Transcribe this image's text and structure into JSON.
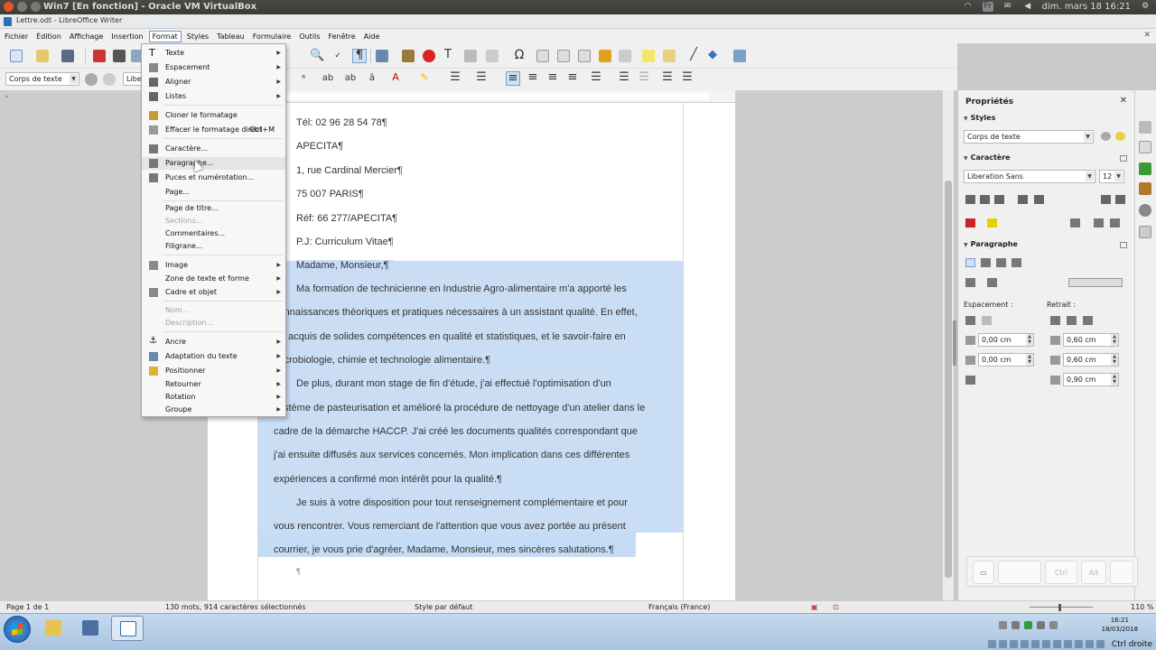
{
  "host": {
    "window_title": "Win7 [En fonction] - Oracle VM VirtualBox",
    "keyboard_layout": "Fr",
    "datetime": "dim. mars 18  16:21"
  },
  "app": {
    "title": "Lettre.odt - LibreOffice Writer"
  },
  "menubar": {
    "items": [
      "Fichier",
      "Édition",
      "Affichage",
      "Insertion",
      "Format",
      "Styles",
      "Tableau",
      "Formulaire",
      "Outils",
      "Fenêtre",
      "Aide"
    ],
    "active": "Format",
    "close_glyph": "✕"
  },
  "toolbar": {
    "paragraph_style": "Corps de texte",
    "font_name_partial": "Libe"
  },
  "format_menu": {
    "items": [
      {
        "label": "Texte",
        "submenu": true
      },
      {
        "label": "Espacement",
        "submenu": true
      },
      {
        "label": "Aligner",
        "submenu": true
      },
      {
        "label": "Listes",
        "submenu": true
      },
      {
        "label": "Cloner le formatage"
      },
      {
        "label": "Effacer le formatage direct",
        "shortcut": "Ctrl+M"
      },
      {
        "label": "Caractère..."
      },
      {
        "label": "Paragraphe..."
      },
      {
        "label": "Puces et numérotation..."
      },
      {
        "label": "Page..."
      },
      {
        "label": "Page de titre..."
      },
      {
        "label": "Sections...",
        "disabled": true
      },
      {
        "label": "Commentaires..."
      },
      {
        "label": "Filigrane..."
      },
      {
        "label": "Image",
        "submenu": true
      },
      {
        "label": "Zone de texte et forme",
        "submenu": true
      },
      {
        "label": "Cadre et objet",
        "submenu": true
      },
      {
        "label": "Nom...",
        "disabled": true
      },
      {
        "label": "Description...",
        "disabled": true
      },
      {
        "label": "Ancre",
        "submenu": true
      },
      {
        "label": "Adaptation du texte",
        "submenu": true
      },
      {
        "label": "Positionner",
        "submenu": true
      },
      {
        "label": "Retourner",
        "submenu": true
      },
      {
        "label": "Rotation",
        "submenu": true
      },
      {
        "label": "Groupe",
        "submenu": true
      }
    ],
    "hovered": "Paragraphe..."
  },
  "document": {
    "lines": [
      "Tél: 02 96 28 54 78¶",
      "APECITA¶",
      "1, rue Cardinal Mercier¶",
      "75 007 PARIS¶",
      "Réf: 66 277/APECITA¶",
      "P.J: Curriculum Vitae¶",
      "Madame, Monsieur,¶",
      "Ma formation de technicienne en Industrie Agro-alimentaire m'a apporté les",
      "connaissances théoriques et pratiques nécessaires à un assistant qualité. En effet,",
      "j'ai acquis de solides compétences en qualité et statistiques, et le savoir-faire en",
      "microbiologie, chimie et technologie alimentaire.¶",
      "De plus, durant mon stage de fin d'étude, j'ai effectué l'optimisation d'un",
      "système de pasteurisation et amélioré la procédure de nettoyage d'un atelier dans le",
      "cadre de la démarche HACCP. J'ai créé les documents qualités correspondant que",
      "j'ai ensuite diffusés aux services concernés. Mon implication dans ces différentes",
      "expériences a confirmé mon intérêt pour la qualité.¶",
      "Je suis à votre disposition pour tout renseignement complémentaire et pour",
      "vous rencontrer. Vous remerciant de l'attention que vous avez portée au présent",
      "courrier, je vous prie d'agréer, Madame, Monsieur, mes sincères salutations.¶",
      "¶"
    ]
  },
  "sidebar": {
    "title": "Propriétés",
    "close_glyph": "✕",
    "sections": {
      "styles": "Styles",
      "caractere": "Caractère",
      "paragraphe": "Paragraphe"
    },
    "style_value": "Corps de texte",
    "font_name": "Liberation Sans",
    "font_size": "12",
    "espacement_label": "Espacement :",
    "retrait_label": "Retrait :",
    "spacing_above": "0,00 cm",
    "spacing_below": "0,00 cm",
    "indent_before": "0,60 cm",
    "indent_after": "0,60 cm",
    "indent_first": "0,90 cm"
  },
  "statusbar": {
    "page": "Page 1 de 1",
    "words": "130 mots, 914 caractères sélectionnés",
    "page_style": "Style par défaut",
    "language": "Français (France)",
    "zoom": "110 %"
  },
  "taskbar": {
    "clock_time": "16:21",
    "clock_date": "18/03/2018",
    "host_key": "Ctrl droite"
  },
  "osk": {
    "ctrl": "Ctrl",
    "alt": "Alt"
  },
  "colors": {
    "selection": "#c6dcf4",
    "host_titlebar": "#3c3b37",
    "menu_active_border": "#6d97c9"
  }
}
